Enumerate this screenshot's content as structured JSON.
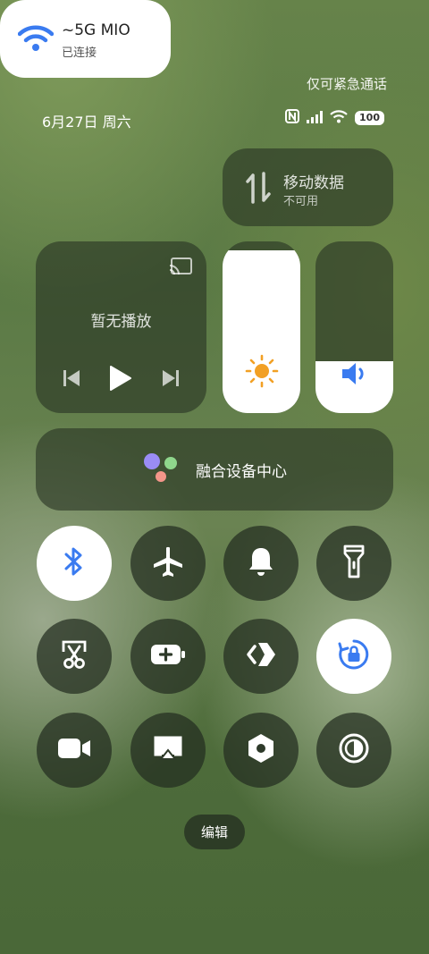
{
  "header": {
    "emergency_text": "仅可紧急通话",
    "date_text": "6月27日 周六",
    "battery_level": "100"
  },
  "wifi": {
    "name": "~5G        MIO",
    "status": "已连接"
  },
  "mobile_data": {
    "title": "移动数据",
    "status": "不可用"
  },
  "media": {
    "title": "暂无播放"
  },
  "brightness": {
    "level": 0.95
  },
  "volume": {
    "level": 0.3
  },
  "fusion": {
    "label": "融合设备中心"
  },
  "toggles": [
    {
      "name": "bluetooth",
      "on": true
    },
    {
      "name": "airplane",
      "on": false
    },
    {
      "name": "ring",
      "on": false
    },
    {
      "name": "flashlight",
      "on": false
    },
    {
      "name": "screenshot",
      "on": false
    },
    {
      "name": "battery-saver",
      "on": false
    },
    {
      "name": "nearby-share",
      "on": false
    },
    {
      "name": "rotation-lock",
      "on": true
    },
    {
      "name": "screen-record",
      "on": false
    },
    {
      "name": "screen-cast",
      "on": false
    },
    {
      "name": "nfc",
      "on": false
    },
    {
      "name": "dark-mode",
      "on": false
    }
  ],
  "footer": {
    "edit_label": "编辑"
  },
  "colors": {
    "accent_blue": "#3a7bf0",
    "sun_orange": "#f2a024"
  }
}
